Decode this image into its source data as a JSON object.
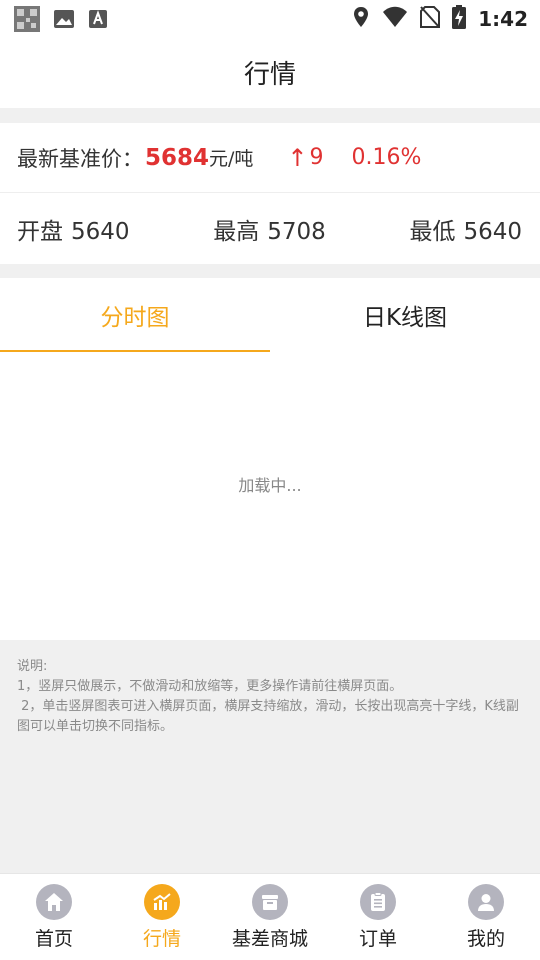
{
  "status_bar": {
    "time": "1:42",
    "left_icons": [
      "qr-thumbnail-icon",
      "image-icon",
      "font-icon"
    ],
    "right_icons": [
      "location-icon",
      "wifi-icon",
      "no-sim-icon",
      "battery-charging-icon"
    ]
  },
  "header": {
    "title": "行情"
  },
  "price": {
    "label": "最新基准价：",
    "value": "5684",
    "unit": "元/吨",
    "change_arrow": "↑",
    "change_value": "9",
    "change_percent": "0.16%",
    "open_label": "开盘",
    "open_value": "5640",
    "high_label": "最高",
    "high_value": "5708",
    "low_label": "最低",
    "low_value": "5640"
  },
  "chart": {
    "tabs": [
      {
        "label": "分时图",
        "active": true
      },
      {
        "label": "日K线图",
        "active": false
      }
    ],
    "loading_text": "加载中..."
  },
  "notes": {
    "title": "说明:",
    "line1": "1，竖屏只做展示，不做滑动和放缩等，更多操作请前往横屏页面。",
    "line2": " 2，单击竖屏图表可进入横屏页面，横屏支持缩放，滑动，长按出现高亮十字线，K线副图可以单击切换不同指标。"
  },
  "bottom_nav": {
    "items": [
      {
        "label": "首页",
        "icon": "home-icon",
        "active": false
      },
      {
        "label": "行情",
        "icon": "chart-icon",
        "active": true
      },
      {
        "label": "基差商城",
        "icon": "store-icon",
        "active": false
      },
      {
        "label": "订单",
        "icon": "clipboard-icon",
        "active": false
      },
      {
        "label": "我的",
        "icon": "user-icon",
        "active": false
      }
    ]
  },
  "colors": {
    "accent": "#f5a81c",
    "up_red": "#e03232",
    "nav_icon_inactive": "#b4b4be"
  }
}
